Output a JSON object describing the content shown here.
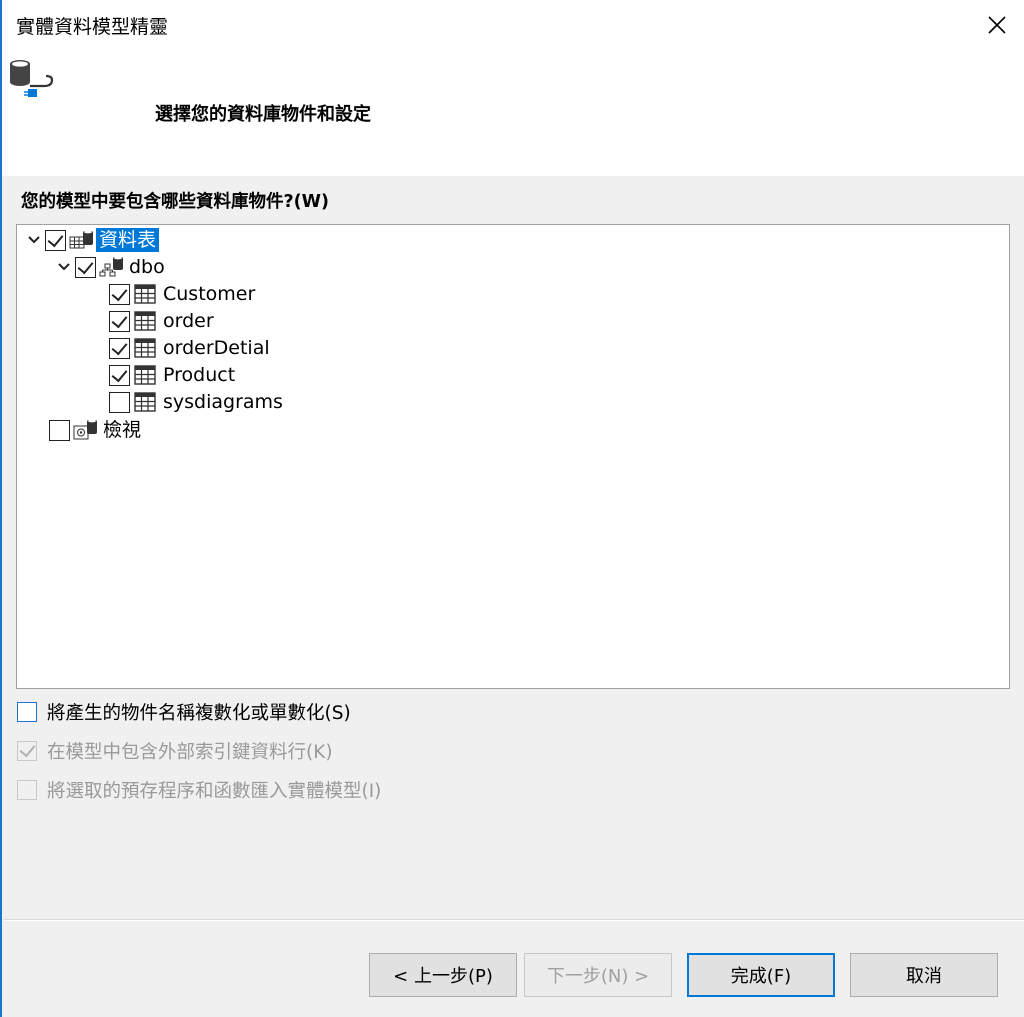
{
  "window": {
    "title": "實體資料模型精靈"
  },
  "header": {
    "heading": "選擇您的資料庫物件和設定"
  },
  "tree_section": {
    "label": "您的模型中要包含哪些資料庫物件?(W)"
  },
  "tree": {
    "tables": {
      "label": "資料表",
      "checked": true,
      "expanded": true,
      "selected": true
    },
    "schema": {
      "label": "dbo",
      "checked": true,
      "expanded": true
    },
    "items": [
      {
        "label": "Customer",
        "checked": true
      },
      {
        "label": "order",
        "checked": true
      },
      {
        "label": "orderDetial",
        "checked": true
      },
      {
        "label": "Product",
        "checked": true
      },
      {
        "label": "sysdiagrams",
        "checked": false
      }
    ],
    "views": {
      "label": "檢視",
      "checked": false
    }
  },
  "options": [
    {
      "label": "將產生的物件名稱複數化或單數化(S)",
      "checked": false,
      "enabled": true
    },
    {
      "label": "在模型中包含外部索引鍵資料行(K)",
      "checked": true,
      "enabled": false
    },
    {
      "label": "將選取的預存程序和函數匯入實體模型(I)",
      "checked": false,
      "enabled": false
    }
  ],
  "buttons": {
    "back": "< 上一步(P)",
    "next": "下一步(N) >",
    "finish": "完成(F)",
    "cancel": "取消"
  },
  "colors": {
    "accent": "#0078d7",
    "window_border": "#1e73d2",
    "background": "#f0f0f0"
  },
  "icons": {
    "close": "close-icon",
    "wizard": "database-connection-icon",
    "tables": "tables-folder-icon",
    "schema": "schema-icon",
    "table": "table-icon",
    "views": "views-folder-icon",
    "expand": "chevron-down-icon"
  }
}
